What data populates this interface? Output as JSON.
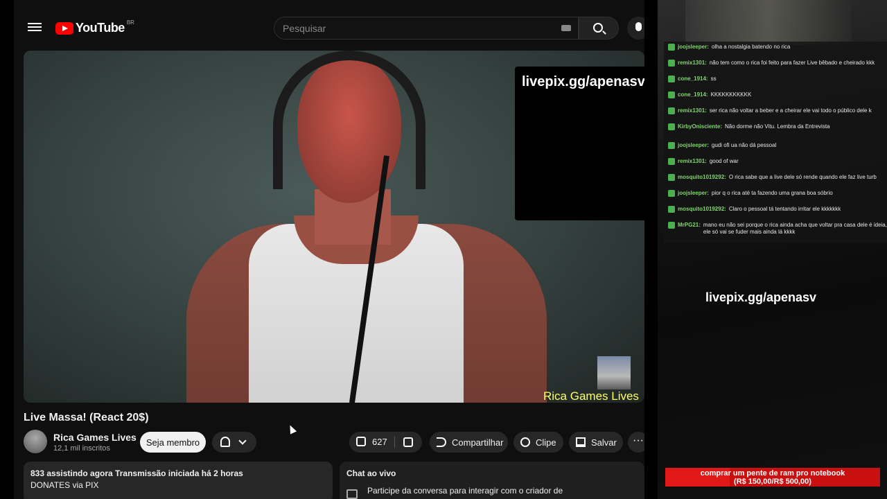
{
  "header": {
    "logo_text": "YouTube",
    "logo_country": "BR",
    "search_placeholder": "Pesquisar"
  },
  "video": {
    "overlay_url": "livepix.gg/apenasv",
    "stream_name": "Rica Games Lives"
  },
  "info": {
    "title": "Live Massa! (React 20$)",
    "channel_name": "Rica Games Lives",
    "subscribers": "12,1 mil inscritos",
    "join_label": "Seja membro",
    "like_count": "627",
    "share_label": "Compartilhar",
    "clip_label": "Clipe",
    "save_label": "Salvar",
    "more_label": "···"
  },
  "description": {
    "line1": "833 assistindo agora  Transmissão iniciada há 2 horas",
    "line2": "DONATES via PIX"
  },
  "chat": {
    "title": "Chat ao vivo",
    "participate": "Participe da conversa para interagir com o criador de"
  },
  "side": {
    "messages": [
      {
        "user": "joojsleeper:",
        "text": "olha a nostalgia batendo no rica"
      },
      {
        "user": "remix1301:",
        "text": "não tem como o rica foi feito para fazer Live bêbado e cheirado kkk"
      },
      {
        "user": "cone_1914:",
        "text": "ss"
      },
      {
        "user": "cone_1914:",
        "text": "KKKKKKKKKKK"
      },
      {
        "user": "remix1301:",
        "text": "ser rica não voltar a beber e a cheirar ele vai todo o público dele k"
      },
      {
        "user": "KirbyOnisciente:",
        "text": "Não dorme não Vitu. Lembra da Entrevista"
      },
      {
        "user": "joojsleeper:",
        "text": "gudi ofi ua não dá pessoal"
      },
      {
        "user": "remix1301:",
        "text": "good of war"
      },
      {
        "user": "mosquito1019292:",
        "text": "O rica sabe que a live dele só rende quando ele faz live turb"
      },
      {
        "user": "joojsleeper:",
        "text": "pior q o rica até ta fazendo uma grana boa sóbrio"
      },
      {
        "user": "mosquito1019292:",
        "text": "Claro o pessoal tá tentando irritar ele kkkkkkk"
      },
      {
        "user": "MrPG21:",
        "text": "mano eu não sei porque o rica ainda acha que voltar pra casa dele é ideia, ele só vai se fuder mais ainda lá kkkk"
      }
    ],
    "url": "livepix.gg/apenasv",
    "goal_title": "comprar um pente de ram pro notebook",
    "goal_amount": "(R$ 150,00/R$ 500,00)",
    "goal_progress": 0.3
  }
}
